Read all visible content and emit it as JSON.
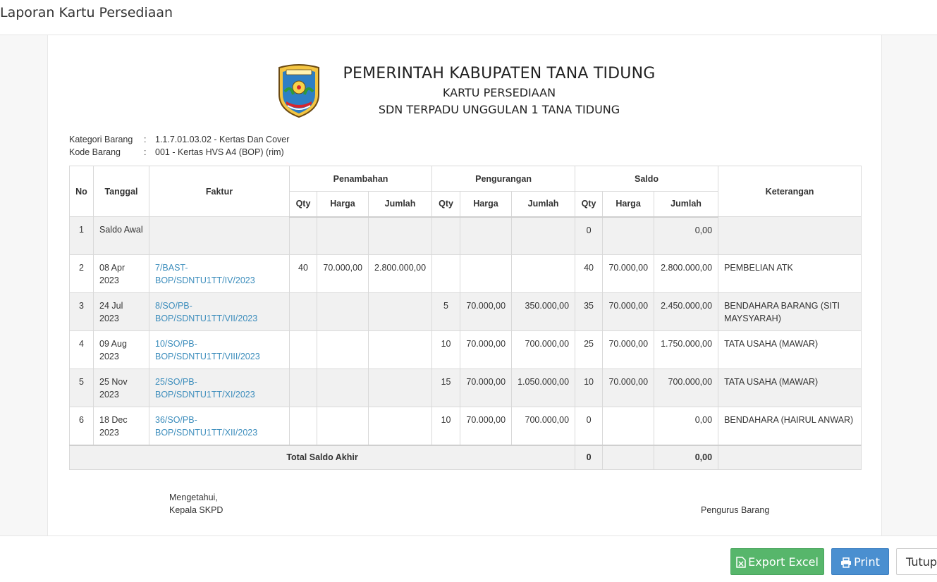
{
  "modal": {
    "title": "Laporan Kartu Persediaan"
  },
  "kop": {
    "line1": "PEMERINTAH KABUPATEN TANA TIDUNG",
    "line2": "KARTU PERSEDIAAN",
    "line3": "SDN TERPADU UNGGULAN 1 TANA TIDUNG",
    "logo_icon": "regency-coat-of-arms-icon"
  },
  "meta": {
    "kategori_label": "Kategori Barang",
    "kategori_value": "1.1.7.01.03.02 - Kertas Dan Cover",
    "kode_label": "Kode Barang",
    "kode_value": "001 - Kertas HVS A4 (BOP) (rim)",
    "colon": ":"
  },
  "table": {
    "headers": {
      "no": "No",
      "tanggal": "Tanggal",
      "faktur": "Faktur",
      "penambahan": "Penambahan",
      "pengurangan": "Pengurangan",
      "saldo": "Saldo",
      "keterangan": "Keterangan",
      "qty": "Qty",
      "harga": "Harga",
      "jumlah": "Jumlah"
    },
    "rows": [
      {
        "no": "1",
        "tanggal": "Saldo Awal",
        "faktur": "",
        "in_qty": "",
        "in_harga": "",
        "in_jumlah": "",
        "out_qty": "",
        "out_harga": "",
        "out_jumlah": "",
        "s_qty": "0",
        "s_harga": "",
        "s_jumlah": "0,00",
        "ket": ""
      },
      {
        "no": "2",
        "tanggal": "08 Apr 2023",
        "faktur": "7/BAST-BOP/SDNTU1TT/IV/2023",
        "in_qty": "40",
        "in_harga": "70.000,00",
        "in_jumlah": "2.800.000,00",
        "out_qty": "",
        "out_harga": "",
        "out_jumlah": "",
        "s_qty": "40",
        "s_harga": "70.000,00",
        "s_jumlah": "2.800.000,00",
        "ket": "PEMBELIAN ATK"
      },
      {
        "no": "3",
        "tanggal": "24 Jul 2023",
        "faktur": "8/SO/PB-BOP/SDNTU1TT/VII/2023",
        "in_qty": "",
        "in_harga": "",
        "in_jumlah": "",
        "out_qty": "5",
        "out_harga": "70.000,00",
        "out_jumlah": "350.000,00",
        "s_qty": "35",
        "s_harga": "70.000,00",
        "s_jumlah": "2.450.000,00",
        "ket": "BENDAHARA BARANG (SITI MAYSYARAH)"
      },
      {
        "no": "4",
        "tanggal": "09 Aug 2023",
        "faktur": "10/SO/PB-BOP/SDNTU1TT/VIII/2023",
        "in_qty": "",
        "in_harga": "",
        "in_jumlah": "",
        "out_qty": "10",
        "out_harga": "70.000,00",
        "out_jumlah": "700.000,00",
        "s_qty": "25",
        "s_harga": "70.000,00",
        "s_jumlah": "1.750.000,00",
        "ket": "TATA USAHA (MAWAR)"
      },
      {
        "no": "5",
        "tanggal": "25 Nov 2023",
        "faktur": "25/SO/PB-BOP/SDNTU1TT/XI/2023",
        "in_qty": "",
        "in_harga": "",
        "in_jumlah": "",
        "out_qty": "15",
        "out_harga": "70.000,00",
        "out_jumlah": "1.050.000,00",
        "s_qty": "10",
        "s_harga": "70.000,00",
        "s_jumlah": "700.000,00",
        "ket": "TATA USAHA (MAWAR)"
      },
      {
        "no": "6",
        "tanggal": "18 Dec 2023",
        "faktur": "36/SO/PB-BOP/SDNTU1TT/XII/2023",
        "in_qty": "",
        "in_harga": "",
        "in_jumlah": "",
        "out_qty": "10",
        "out_harga": "70.000,00",
        "out_jumlah": "700.000,00",
        "s_qty": "0",
        "s_harga": "",
        "s_jumlah": "0,00",
        "ket": "BENDAHARA (HAIRUL ANWAR)"
      }
    ],
    "total": {
      "label": "Total Saldo Akhir",
      "qty": "0",
      "jumlah": "0,00"
    }
  },
  "signature": {
    "left_line1": "Mengetahui,",
    "left_line2": "Kepala SKPD",
    "right_line1": "Pengurus Barang"
  },
  "footer": {
    "export_label": "Export Excel",
    "export_icon": "file-excel-icon",
    "print_label": "Print",
    "print_icon": "printer-icon",
    "close_label": "Tutup"
  },
  "colors": {
    "excel_button": "#57b66b",
    "print_button": "#4a8fd0",
    "link": "#3c8dbc",
    "row_stripe": "#f1f1f1"
  }
}
